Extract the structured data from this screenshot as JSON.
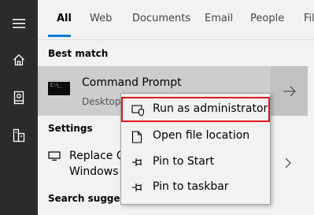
{
  "rail": {
    "items": [
      {
        "icon": "hamburger-menu-icon"
      },
      {
        "icon": "home-icon"
      },
      {
        "icon": "notebook-icon"
      },
      {
        "icon": "tower-icon"
      }
    ]
  },
  "tabs": [
    {
      "label": "All",
      "active": true
    },
    {
      "label": "Web"
    },
    {
      "label": "Documents"
    },
    {
      "label": "Email"
    },
    {
      "label": "People"
    },
    {
      "label": "Filt"
    }
  ],
  "best_match": {
    "heading": "Best match",
    "title": "Command Prompt",
    "subtitle": "Desktop",
    "icon_text": "C:\\_"
  },
  "settings": {
    "heading": "Settings",
    "item_line1": "Replace C",
    "item_line2": "Windows"
  },
  "search_suggestions": {
    "heading": "Search suggestio"
  },
  "context_menu": {
    "items": [
      {
        "label": "Run as administrator",
        "icon": "shield-admin-icon",
        "highlighted": true
      },
      {
        "label": "Open file location",
        "icon": "file-icon"
      },
      {
        "label": "Pin to Start",
        "icon": "pin-icon"
      },
      {
        "label": "Pin to taskbar",
        "icon": "pin-icon"
      }
    ]
  },
  "colors": {
    "accent": "#0078d7",
    "highlight_border": "#e0161b",
    "rail_bg": "#2b2b2b",
    "selected_row_bg": "#cdcdcd"
  }
}
